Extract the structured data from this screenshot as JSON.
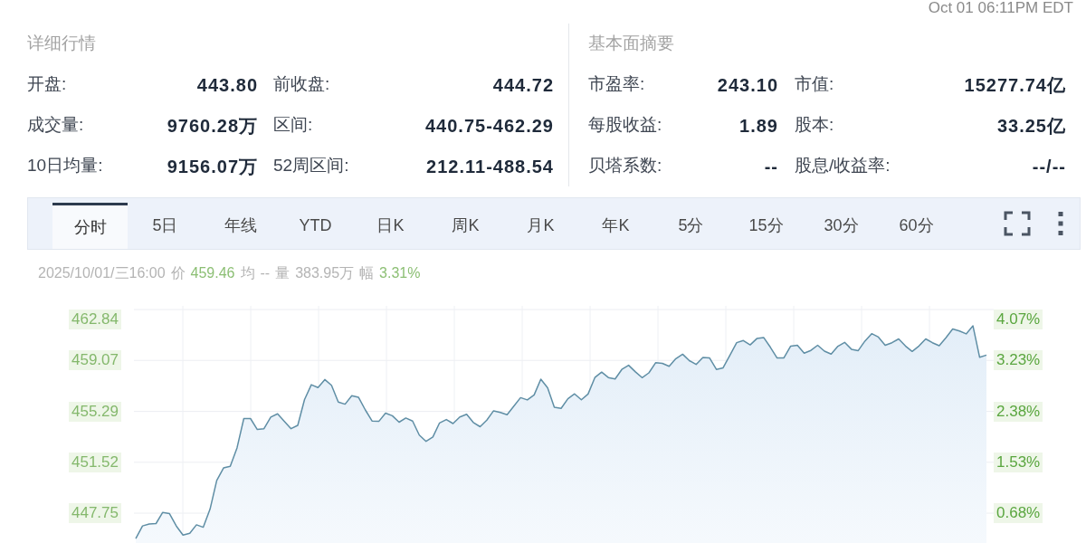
{
  "timestamp": "Oct 01 06:11PM EDT",
  "quote_details": {
    "title": "详细行情",
    "rows": [
      {
        "label": "开盘:",
        "value": "443.80",
        "label_2": "前收盘:",
        "value_2": "444.72"
      },
      {
        "label": "成交量:",
        "value": "9760.28万",
        "label_2": "区间:",
        "value_2": "440.75-462.29"
      },
      {
        "label": "10日均量:",
        "value": "9156.07万",
        "label_2": "52周区间:",
        "value_2": "212.11-488.54"
      }
    ]
  },
  "fundamentals": {
    "title": "基本面摘要",
    "rows": [
      {
        "label": "市盈率:",
        "value": "243.10",
        "label_2": "市值:",
        "value_2": "15277.74亿"
      },
      {
        "label": "每股收益:",
        "value": "1.89",
        "label_2": "股本:",
        "value_2": "33.25亿"
      },
      {
        "label": "贝塔系数:",
        "value": "--",
        "label_2": "股息/收益率:",
        "value_2": "--/--"
      }
    ]
  },
  "period_tabs": [
    {
      "label": "分时",
      "selected": true
    },
    {
      "label": "5日",
      "selected": false
    },
    {
      "label": "年线",
      "selected": false
    },
    {
      "label": "YTD",
      "selected": false
    },
    {
      "label": "日K",
      "selected": false
    },
    {
      "label": "周K",
      "selected": false
    },
    {
      "label": "月K",
      "selected": false
    },
    {
      "label": "年K",
      "selected": false
    },
    {
      "label": "5分",
      "selected": false
    },
    {
      "label": "15分",
      "selected": false
    },
    {
      "label": "30分",
      "selected": false
    },
    {
      "label": "60分",
      "selected": false
    }
  ],
  "hover_info": {
    "date": "2025/10/01/三16:00",
    "items": [
      {
        "label": "价",
        "value": "459.46",
        "color": "#8cbf74"
      },
      {
        "label": "均",
        "value": "--",
        "color": "#b4b4b4"
      },
      {
        "label": "量",
        "value": "383.95万",
        "color": "#b4b4b4"
      },
      {
        "label": "幅",
        "value": "3.31%",
        "color": "#8cbf74"
      }
    ]
  },
  "price_chart": {
    "chart_data": {
      "type": "area",
      "grid": true,
      "ylim": [
        445.54,
        463.11
      ],
      "yticks": [
        {
          "value": 462.84,
          "label": "462.84"
        },
        {
          "value": 459.07,
          "label": "459.07"
        },
        {
          "value": 455.29,
          "label": "455.29"
        },
        {
          "value": 451.52,
          "label": "451.52"
        },
        {
          "value": 447.75,
          "label": "447.75"
        }
      ],
      "values": [
        445.86,
        446.81,
        446.95,
        446.98,
        447.81,
        447.71,
        446.8,
        446.13,
        446.26,
        446.89,
        446.71,
        448.05,
        450.18,
        451.1,
        451.22,
        452.59,
        454.76,
        454.76,
        453.95,
        454.01,
        454.87,
        455.11,
        454.55,
        454.01,
        454.26,
        456.17,
        457.27,
        457.06,
        457.65,
        457.22,
        455.99,
        455.83,
        456.46,
        456.33,
        455.4,
        454.58,
        454.55,
        455.16,
        454.97,
        454.49,
        454.8,
        454.57,
        453.54,
        453.07,
        453.39,
        454.44,
        454.69,
        454.39,
        454.88,
        455.08,
        454.47,
        454.16,
        454.65,
        455.34,
        455.22,
        455.05,
        455.68,
        456.31,
        456.14,
        456.51,
        457.68,
        457.04,
        455.6,
        455.52,
        456.23,
        456.59,
        456.15,
        456.58,
        457.8,
        458.2,
        457.8,
        457.7,
        458.4,
        458.71,
        458.22,
        457.79,
        458.15,
        458.9,
        458.85,
        458.63,
        459.2,
        459.53,
        459.05,
        458.77,
        459.29,
        459.25,
        458.4,
        458.52,
        459.44,
        460.39,
        460.54,
        460.22,
        460.69,
        460.77,
        460.04,
        459.25,
        459.26,
        460.13,
        460.2,
        459.61,
        459.81,
        460.19,
        459.76,
        459.54,
        460.12,
        460.41,
        459.9,
        459.8,
        460.5,
        461.05,
        460.8,
        460.19,
        460.38,
        460.66,
        460.14,
        459.74,
        460.14,
        460.66,
        460.38,
        460.16,
        460.74,
        461.4,
        461.25,
        461.04,
        461.63,
        459.3,
        459.46
      ]
    },
    "percent_labels": [
      "4.07%",
      "3.23%",
      "2.38%",
      "1.53%",
      "0.68%"
    ]
  }
}
